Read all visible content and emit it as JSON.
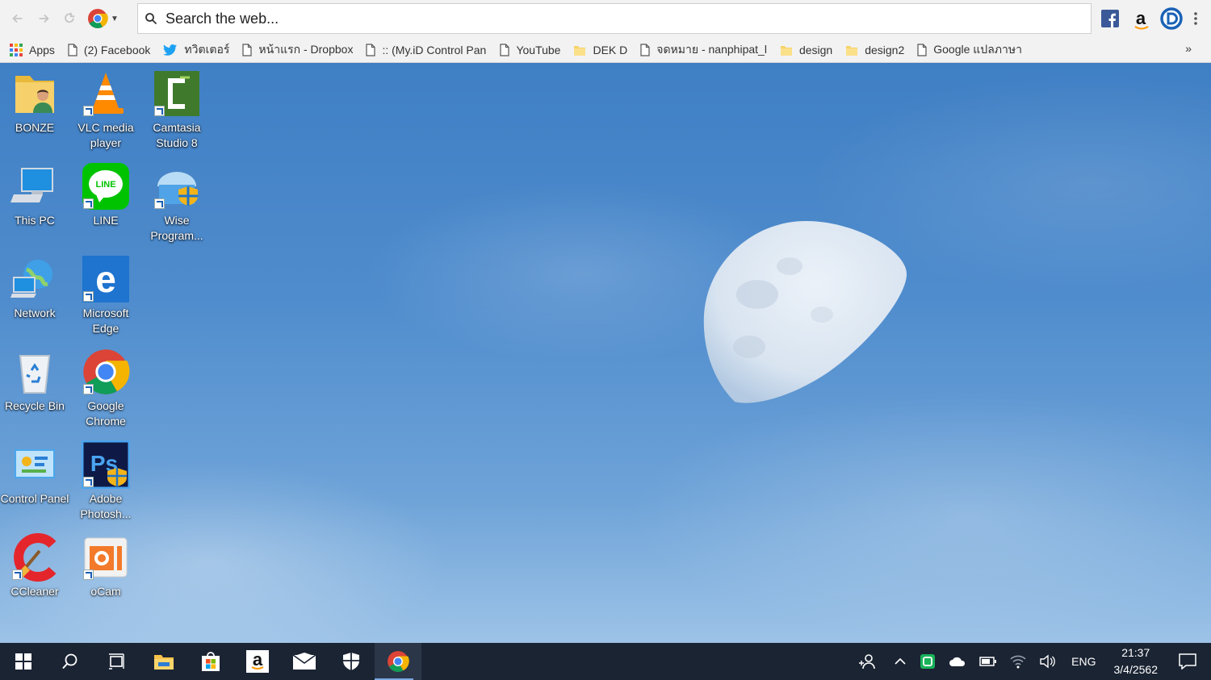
{
  "browser": {
    "search_placeholder": "Search the web...",
    "extensions": [
      "facebook-extension",
      "amazon-extension",
      "dashlane-extension"
    ],
    "amazon_glyph": "a"
  },
  "bookmarks": {
    "apps_label": "Apps",
    "items": [
      {
        "label": "(2) Facebook",
        "icon": "page-icon"
      },
      {
        "label": "ทวิตเตอร์",
        "icon": "twitter-icon"
      },
      {
        "label": "หน้าแรก - Dropbox",
        "icon": "page-icon"
      },
      {
        "label": ":: (My.iD Control Pane",
        "icon": "page-icon"
      },
      {
        "label": "YouTube",
        "icon": "page-icon"
      },
      {
        "label": "DEK D",
        "icon": "folder-icon"
      },
      {
        "label": "จดหมาย - nanphipat_l",
        "icon": "page-icon"
      },
      {
        "label": "design",
        "icon": "folder-icon"
      },
      {
        "label": "design2",
        "icon": "folder-icon"
      },
      {
        "label": "Google แปลภาษา",
        "icon": "page-icon"
      }
    ],
    "more": "»"
  },
  "desktop": {
    "icons": [
      {
        "label": "BONZE",
        "icon": "user-folder-icon"
      },
      {
        "label": "VLC media player",
        "icon": "vlc-icon"
      },
      {
        "label": "Camtasia Studio 8",
        "icon": "camtasia-icon"
      },
      {
        "label": "This PC",
        "icon": "computer-icon"
      },
      {
        "label": "LINE",
        "icon": "line-icon"
      },
      {
        "label": "Wise Program...",
        "icon": "wise-icon"
      },
      {
        "label": "Network",
        "icon": "network-icon"
      },
      {
        "label": "Microsoft Edge",
        "icon": "edge-icon"
      },
      {
        "label": "Recycle Bin",
        "icon": "recycle-bin-icon"
      },
      {
        "label": "Google Chrome",
        "icon": "chrome-icon"
      },
      {
        "label": "Control Panel",
        "icon": "control-panel-icon"
      },
      {
        "label": "Adobe Photosh...",
        "icon": "photoshop-icon"
      },
      {
        "label": "CCleaner",
        "icon": "ccleaner-icon"
      },
      {
        "label": "oCam",
        "icon": "ocam-icon"
      }
    ],
    "icon_texts": {
      "line": "LINE",
      "photoshop": "Ps",
      "edge": "e"
    }
  },
  "taskbar": {
    "pinned": [
      "start-icon",
      "search-icon",
      "task-view-icon",
      "file-explorer-icon",
      "store-icon",
      "amazon-icon",
      "mail-icon",
      "security-icon",
      "chrome-icon"
    ],
    "active": "chrome-icon",
    "amazon_glyph": "a",
    "language": "ENG",
    "time": "21:37",
    "date": "3/4/2562"
  }
}
